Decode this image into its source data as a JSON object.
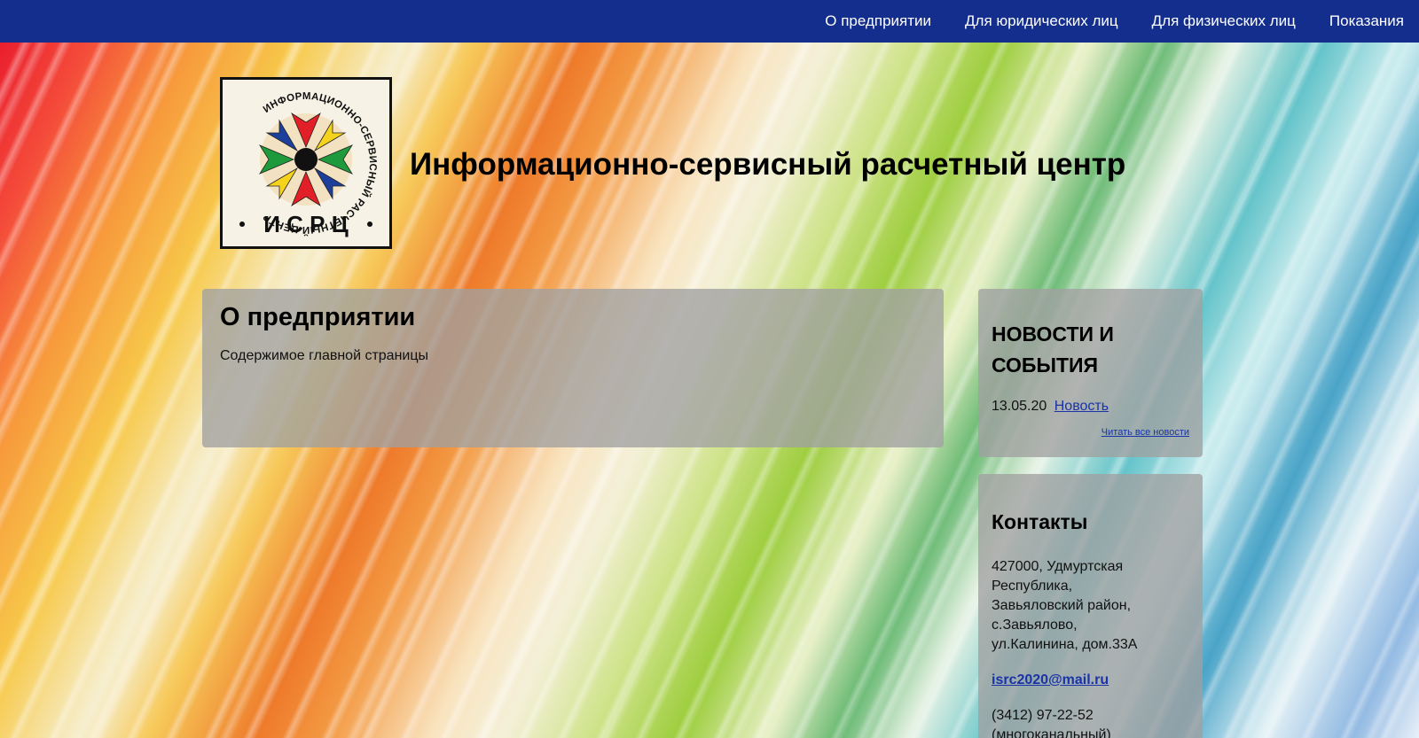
{
  "nav": {
    "items": [
      {
        "label": "О предприятии"
      },
      {
        "label": "Для юридических лиц"
      },
      {
        "label": "Для физических лиц"
      },
      {
        "label": "Показания"
      }
    ]
  },
  "header": {
    "logo_ring_text": "ИНФОРМАЦИОННО-СЕРВИСНЫЙ РАСЧЕТНЫЙ ЦЕНТР",
    "logo_abbr": "И С Р Ц",
    "title": "Информационно-сервисный расчетный центр"
  },
  "main": {
    "heading": "О предприятии",
    "text": "Содержимое главной страницы"
  },
  "news": {
    "heading": "НОВОСТИ И СОБЫТИЯ",
    "date": "13.05.20",
    "link": "Новость",
    "read_all": "Читать все новости"
  },
  "contacts": {
    "heading": "Контакты",
    "address_lines": [
      "427000, Удмуртская",
      "Республика,",
      "Завьяловский район,",
      "с.Завьялово,",
      "ул.Калинина, дом.33А"
    ],
    "email": " isrc2020@mail.ru",
    "phone_lines": [
      "(3412) 97-22-52",
      "(многоканальный)"
    ]
  },
  "colors": {
    "nav_bg": "#132e8c",
    "link": "#1a33a8",
    "panel": "rgba(160,160,160,0.78)"
  }
}
